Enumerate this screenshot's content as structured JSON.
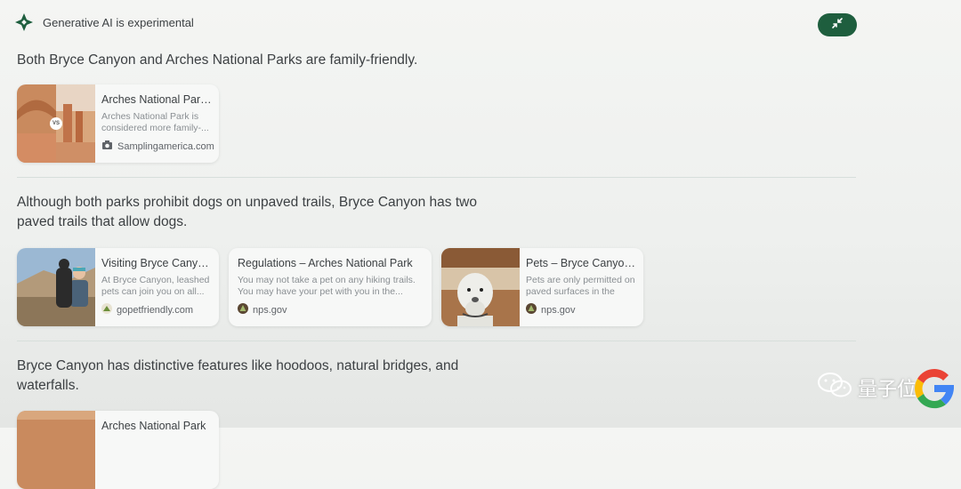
{
  "header": {
    "label": "Generative AI is experimental"
  },
  "sections": [
    {
      "statement": "Both Bryce Canyon and Arches National Parks are family-friendly.",
      "cards": [
        {
          "title": "Arches National Park...",
          "snippet": "Arches National Park is considered more family-...",
          "source": "Samplingamerica.com",
          "favicon": "camera-favicon"
        }
      ]
    },
    {
      "statement_line1": "Although both parks prohibit dogs on unpaved trails, Bryce Canyon has two",
      "statement_line2": "paved trails that allow dogs.",
      "cards": [
        {
          "title": "Visiting Bryce Canyo...",
          "snippet": "At Bryce Canyon, leashed pets can join you on all...",
          "source": "gopetfriendly.com",
          "favicon": "paw-favicon"
        },
        {
          "title": "Regulations – Arches National Park",
          "snippet": "You may not take a pet on any hiking trails. You may have your pet with you in the...",
          "source": "nps.gov",
          "favicon": "nps-arrowhead-favicon"
        },
        {
          "title": "Pets – Bryce Canyon...",
          "snippet": "Pets are only permitted on paved surfaces in the par...",
          "source": "nps.gov",
          "favicon": "nps-arrowhead-favicon"
        }
      ]
    },
    {
      "statement_line1": "Bryce Canyon has distinctive features like hoodoos, natural bridges, and",
      "statement_line2": "waterfalls.",
      "cards": [
        {
          "title": "Arches National Park"
        }
      ]
    }
  ],
  "watermark": {
    "text": "量子位"
  },
  "colors": {
    "accent_green": "#1e5e3e",
    "text": "#3c4043",
    "muted": "#8a8f93"
  }
}
